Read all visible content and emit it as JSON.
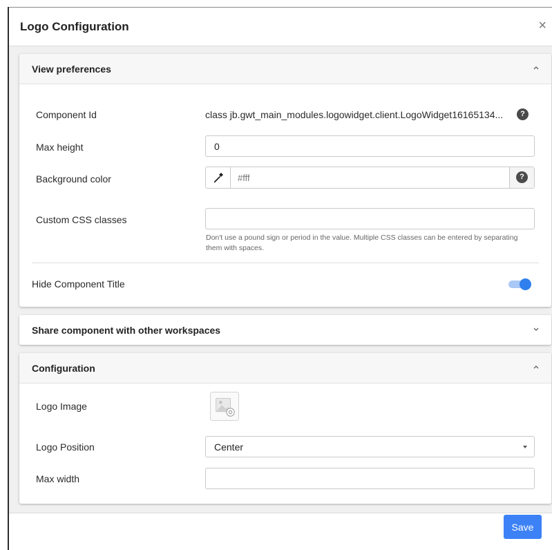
{
  "dialog": {
    "title": "Logo Configuration",
    "close_icon": "close-icon",
    "save_label": "Save"
  },
  "view_preferences": {
    "title": "View preferences",
    "expanded": true,
    "component_id_label": "Component Id",
    "component_id_value": "class jb.gwt_main_modules.logowidget.client.LogoWidget16165134...",
    "max_height_label": "Max height",
    "max_height_value": "0",
    "background_color_label": "Background color",
    "background_color_value": "#fff",
    "custom_css_label": "Custom CSS classes",
    "custom_css_value": "",
    "custom_css_hint": "Don't use a pound sign or period in the value. Multiple CSS classes can be entered by separating them with spaces.",
    "hide_title_label": "Hide Component Title",
    "hide_title_enabled": true
  },
  "share_section": {
    "title": "Share component with other workspaces",
    "expanded": false
  },
  "configuration": {
    "title": "Configuration",
    "expanded": true,
    "logo_image_label": "Logo Image",
    "logo_position_label": "Logo Position",
    "logo_position_value": "Center",
    "max_width_label": "Max width",
    "max_width_value": ""
  },
  "colors": {
    "accent": "#3c82f6",
    "toggle_track": "#a9c8f7",
    "body_bg": "#f0f0f0"
  }
}
